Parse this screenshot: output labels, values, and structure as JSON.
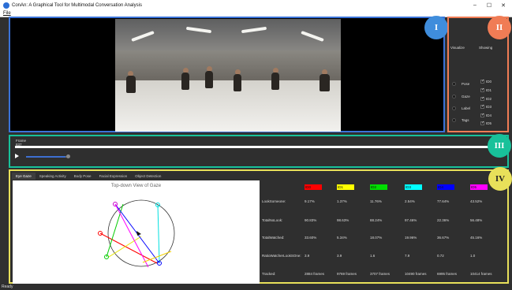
{
  "window": {
    "title": "ConAn: A Graphical Tool for Multimodal Conversation Analysis",
    "minimize": "–",
    "maximize": "☐",
    "close": "✕"
  },
  "menu": {
    "file": "File"
  },
  "badges": {
    "section1": "I",
    "section2": "II",
    "section3": "III",
    "section4": "IV"
  },
  "visualize_panel": {
    "visualize_header": "Visualize",
    "showing_header": "Showing",
    "options": [
      "Pose",
      "Gaze",
      "Label",
      "Tags"
    ],
    "ids": [
      "ID0",
      "ID1",
      "ID2",
      "ID3",
      "ID4",
      "ID5"
    ],
    "checkmark": "✓"
  },
  "timeline": {
    "frame_label": "Frame",
    "frame_value": "837"
  },
  "tabs": [
    "Eye Gaze",
    "Speaking Activity",
    "Body Pose",
    "Facial Expression",
    "Object Detection"
  ],
  "gaze_plot": {
    "title": "Top-down View of Gaze"
  },
  "stats": {
    "columns": [
      {
        "label": "ID0",
        "color": "#ff0000"
      },
      {
        "label": "ID1",
        "color": "#ffff00"
      },
      {
        "label": "ID2",
        "color": "#00dd00"
      },
      {
        "label": "ID3",
        "color": "#00ffff"
      },
      {
        "label": "ID4",
        "color": "#0000ff"
      },
      {
        "label": "ID5",
        "color": "#ff00ff"
      }
    ],
    "rows": [
      {
        "label": "LookSomeone:",
        "values": [
          "9.17%",
          "1.37%",
          "11.76%",
          "2.54%",
          "77.64%",
          "43.52%"
        ]
      },
      {
        "label": "TotalNoLook:",
        "values": [
          "90.83%",
          "98.63%",
          "88.24%",
          "97.46%",
          "22.36%",
          "56.48%"
        ]
      },
      {
        "label": "TotalWatched:",
        "values": [
          "33.60%",
          "5.34%",
          "18.07%",
          "19.96%",
          "36.67%",
          "45.16%"
        ]
      },
      {
        "label": "RatioWatcherLookSOne:",
        "values": [
          "3.9",
          "3.9",
          "1.6",
          "7.9",
          "0.72",
          "1.0"
        ]
      },
      {
        "label": "Tracked:",
        "values": [
          "2884 frames",
          "9769 frames",
          "3707 frames",
          "10490 frames",
          "6995 frames",
          "10414 frames"
        ]
      }
    ]
  },
  "status": {
    "text": "Ready"
  }
}
